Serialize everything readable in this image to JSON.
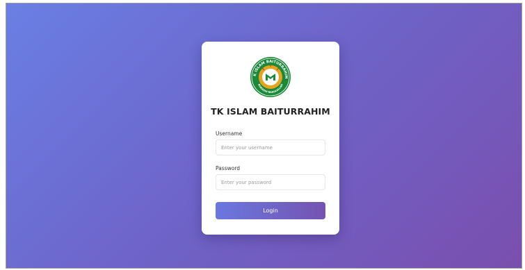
{
  "login_card": {
    "logo": {
      "icon": "school-emblem-icon",
      "ring_text_top": "TK ISLAM BAITURRAHIM",
      "ring_text_bottom": "BUKASIH RASULULLAH"
    },
    "title": "TK ISLAM BAITURRAHIM",
    "username": {
      "label": "Username",
      "placeholder": "Enter your username",
      "value": ""
    },
    "password": {
      "label": "Password",
      "placeholder": "Enter your password",
      "value": ""
    },
    "login_label": "Login"
  },
  "colors": {
    "background_start": "#6a7fe4",
    "background_end": "#7a4fae",
    "button_start": "#6a78e0",
    "button_end": "#7553b0",
    "logo_green": "#1a8a3a"
  }
}
